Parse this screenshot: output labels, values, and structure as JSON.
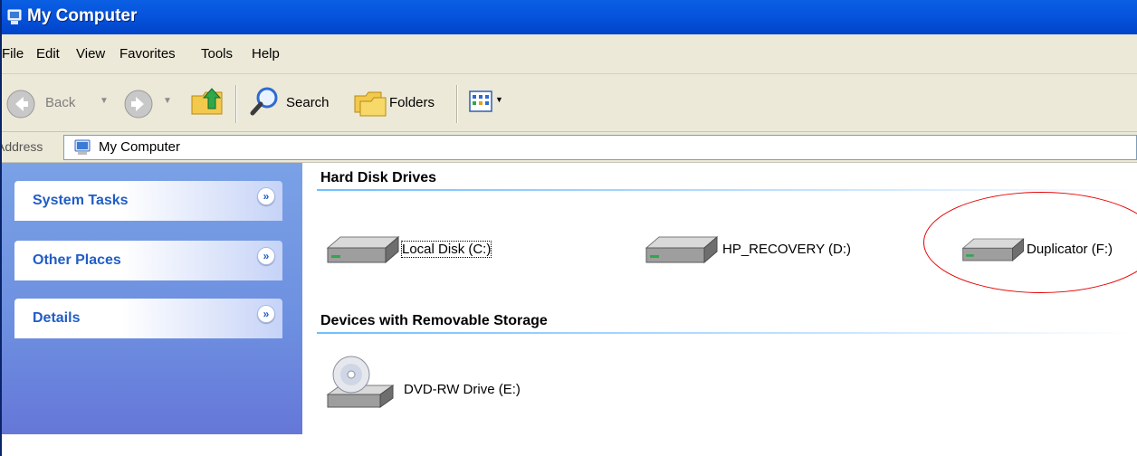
{
  "window": {
    "title": "My Computer"
  },
  "menu": [
    "File",
    "Edit",
    "View",
    "Favorites",
    "Tools",
    "Help"
  ],
  "toolbar": {
    "back_label": "Back",
    "search_label": "Search",
    "folders_label": "Folders"
  },
  "address": {
    "label": "Address",
    "value": "My Computer"
  },
  "task_pane": {
    "groups": [
      {
        "label": "System Tasks"
      },
      {
        "label": "Other Places"
      },
      {
        "label": "Details"
      }
    ]
  },
  "content": {
    "sections": [
      {
        "title": "Hard Disk Drives",
        "items": [
          {
            "label": "Local Disk (C:)"
          },
          {
            "label": "HP_RECOVERY (D:)"
          },
          {
            "label": "Duplicator (F:)"
          }
        ]
      },
      {
        "title": "Devices with Removable Storage",
        "items": [
          {
            "label": "DVD-RW Drive (E:)"
          }
        ]
      }
    ]
  },
  "colors": {
    "titlebar_blue": "#0654dd",
    "taskpane_blue": "#7aa1e6",
    "task_label_blue": "#215dc6",
    "highlight_red": "#e60000"
  }
}
